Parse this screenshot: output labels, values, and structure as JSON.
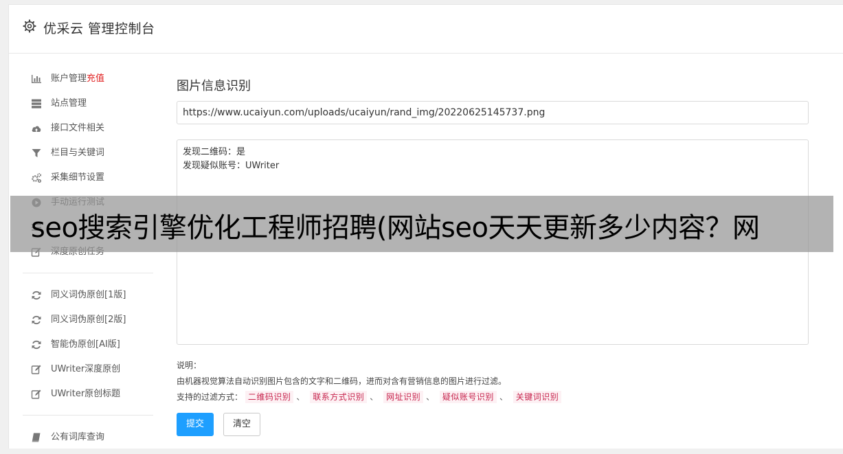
{
  "header": {
    "title": "优采云 管理控制台",
    "icon": "gear-icon"
  },
  "sidebar": {
    "groups": [
      [
        {
          "label": "账户管理",
          "extra": "充值",
          "icon": "bar-chart-icon"
        },
        {
          "label": "站点管理",
          "icon": "server-icon"
        },
        {
          "label": "接口文件相关",
          "icon": "cloud-upload-icon"
        },
        {
          "label": "栏目与关键词",
          "icon": "filter-icon"
        },
        {
          "label": "采集细节设置",
          "icon": "gears-icon"
        },
        {
          "label": "手动运行测试",
          "icon": "play-circle-icon"
        },
        {
          "label": "",
          "icon": "list-icon"
        },
        {
          "label": "深度原创任务",
          "icon": "edit-icon"
        }
      ],
      [
        {
          "label": "同义词伪原创[1版]",
          "icon": "refresh-icon"
        },
        {
          "label": "同义词伪原创[2版]",
          "icon": "refresh-icon"
        },
        {
          "label": "智能伪原创[AI版]",
          "icon": "refresh-icon"
        },
        {
          "label": "UWriter深度原创",
          "icon": "edit-icon"
        },
        {
          "label": "UWriter原创标题",
          "icon": "edit-icon"
        }
      ],
      [
        {
          "label": "公有词库查询",
          "icon": "book-icon"
        }
      ]
    ]
  },
  "main": {
    "section_title": "图片信息识别",
    "url_value": "https://www.ucaiyun.com/uploads/ucaiyun/rand_img/20220625145737.png",
    "result_lines": [
      "发现二维码：是",
      "发现疑似账号：UWriter"
    ],
    "note_title": "说明：",
    "note_desc": "由机器视觉算法自动识别图片包含的文字和二维码，进而对含有营销信息的图片进行过滤。",
    "filters_label": "支持的过滤方式：",
    "filters": [
      "二维码识别",
      "联系方式识别",
      "网址识别",
      "疑似账号识别",
      "关键词识别"
    ],
    "separator": "、",
    "submit_label": "提交",
    "clear_label": "清空"
  },
  "banner": {
    "text": "seo搜索引擎优化工程师招聘(网站seo天天更新多少内容？网"
  },
  "colors": {
    "primary": "#1e9fff",
    "danger": "#e02020",
    "tag_text": "#c7254e",
    "tag_bg": "#fdf1f4"
  }
}
